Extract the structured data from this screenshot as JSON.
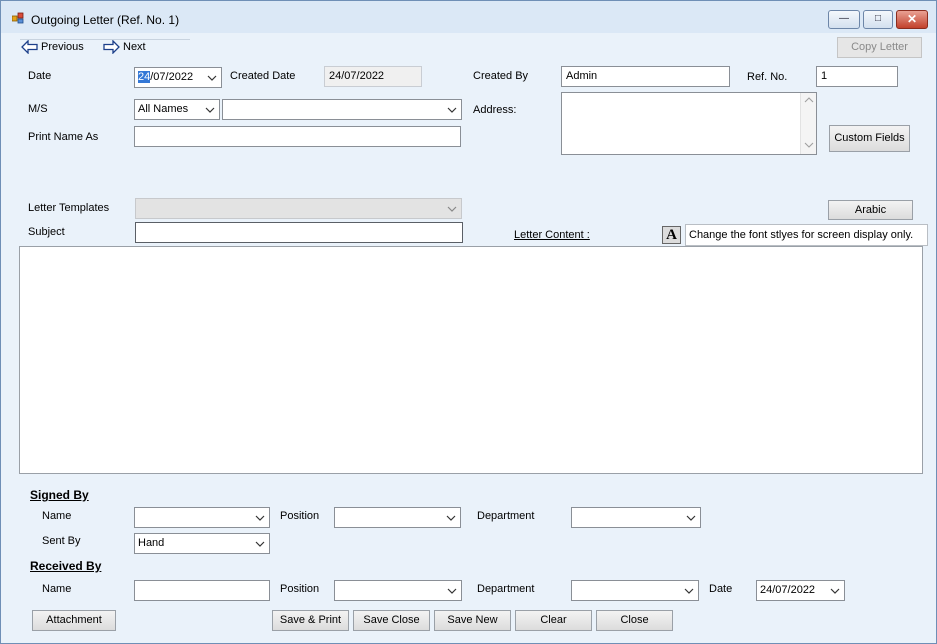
{
  "window": {
    "title": "Outgoing Letter (Ref. No. 1)",
    "controls": {
      "minimize": "—",
      "maximize": "□",
      "close": "✕"
    }
  },
  "nav": {
    "previous": "Previous",
    "next": "Next",
    "copy_letter": "Copy Letter"
  },
  "header": {
    "date_label": "Date",
    "date_value_day": "24",
    "date_value_rest": "/07/2022",
    "created_date_label": "Created Date",
    "created_date_value": "24/07/2022",
    "created_by_label": "Created By",
    "created_by_value": "Admin",
    "ref_no_label": "Ref. No.",
    "ref_no_value": "1",
    "ms_label": "M/S",
    "ms_filter_value": "All Names",
    "ms_name_value": "",
    "address_label": "Address:",
    "address_value": "",
    "print_name_label": "Print Name As",
    "print_name_value": "",
    "custom_fields": "Custom Fields"
  },
  "letter": {
    "templates_label": "Letter Templates",
    "templates_value": "",
    "subject_label": "Subject",
    "subject_value": "",
    "arabic_button": "Arabic",
    "content_label": "Letter Content :",
    "font_icon": "A",
    "font_hint": "Change the font stlyes for screen display only.",
    "content_value": ""
  },
  "signed_by": {
    "section_title": "Signed By",
    "name_label": "Name",
    "name_value": "",
    "position_label": "Position",
    "position_value": "",
    "department_label": "Department",
    "department_value": "",
    "sent_by_label": "Sent By",
    "sent_by_value": "Hand"
  },
  "received_by": {
    "section_title": "Received By",
    "name_label": "Name",
    "name_value": "",
    "position_label": "Position",
    "position_value": "",
    "department_label": "Department",
    "department_value": "",
    "date_label": "Date",
    "date_value": "24/07/2022"
  },
  "footer": {
    "attachment": "Attachment",
    "save_print": "Save & Print",
    "save_close": "Save Close",
    "save_new": "Save New",
    "clear": "Clear",
    "close": "Close"
  },
  "colors": {
    "window_bg": "#eaf2fa",
    "titlebar": "#dbe8f6",
    "close_button": "#c2412c",
    "selection": "#3478d6"
  }
}
